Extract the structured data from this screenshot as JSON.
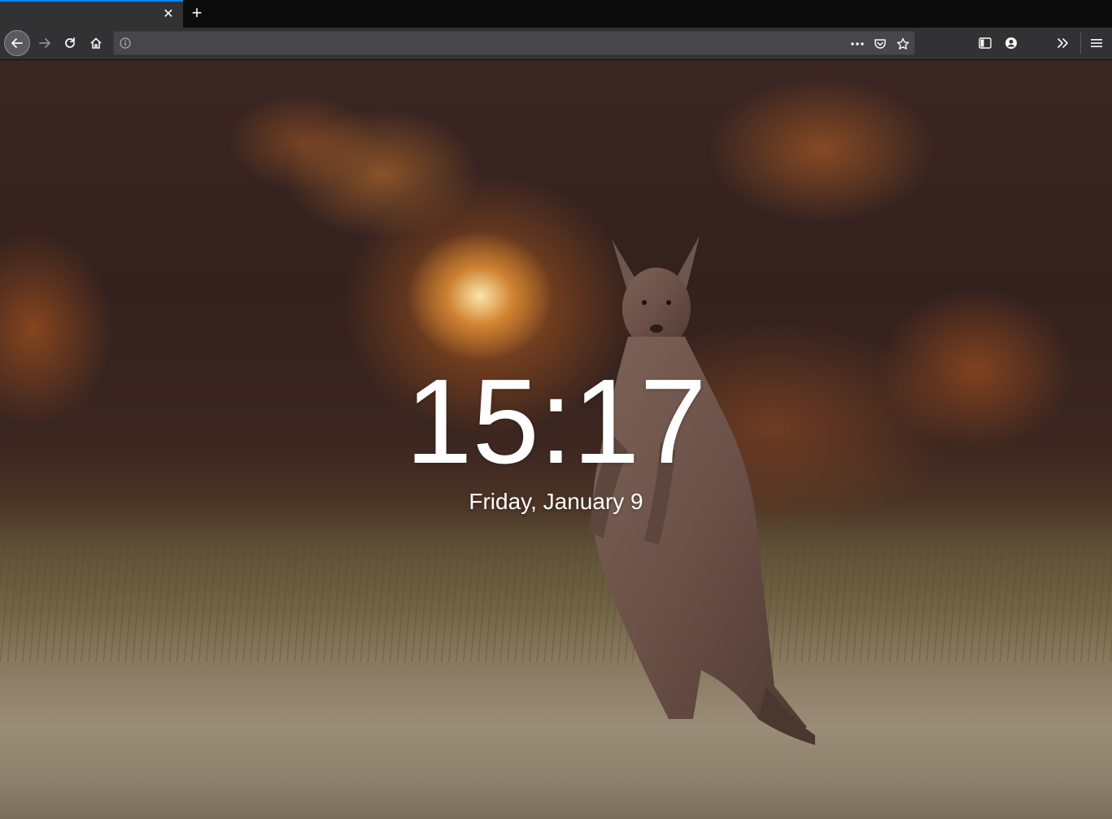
{
  "browser": {
    "tabs": [
      {
        "title": "",
        "active": true,
        "close_icon": "close-icon"
      }
    ],
    "new_tab_icon": "plus-icon",
    "navbar": {
      "back_icon": "arrow-left-icon",
      "forward_icon": "arrow-right-icon",
      "reload_icon": "reload-icon",
      "home_icon": "home-icon",
      "urlbar": {
        "value": "",
        "placeholder": "",
        "info_icon": "info-icon",
        "page_actions_icon": "ellipsis-icon",
        "pocket_icon": "pocket-icon",
        "bookmark_icon": "star-icon"
      },
      "sidebar_icon": "sidebar-icon",
      "account_icon": "account-icon",
      "overflow_icon": "double-chevron-right-icon",
      "menu_icon": "hamburger-menu-icon"
    },
    "accent_color": "#0a84ff"
  },
  "newtab": {
    "time": "15:17",
    "date": "Friday, January 9"
  }
}
